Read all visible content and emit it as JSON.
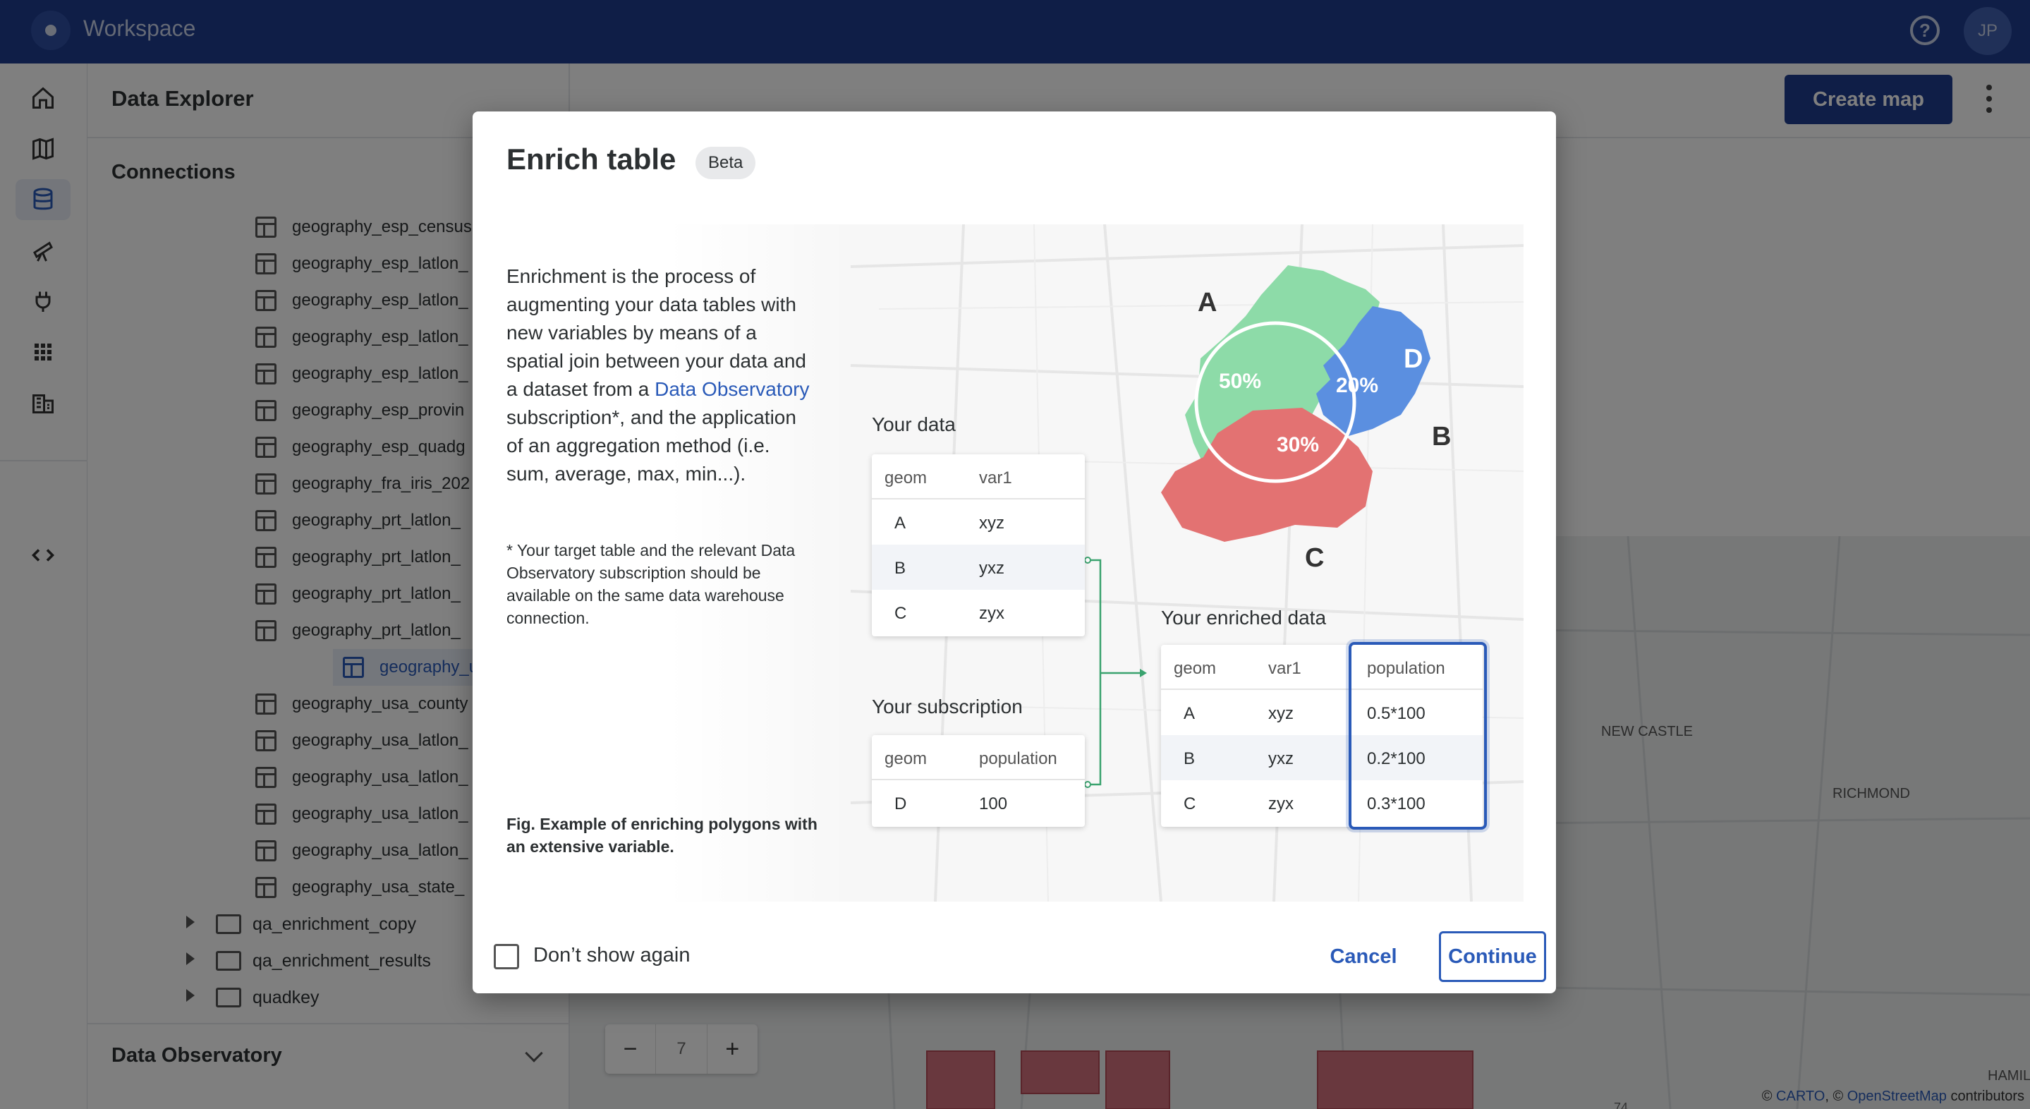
{
  "app": {
    "title": "Workspace",
    "avatar_initials": "JP"
  },
  "rail": {
    "items": [
      "home-icon",
      "map-icon",
      "database-icon",
      "telescope-icon",
      "plug-icon",
      "apps-icon",
      "buildings-icon",
      "code-icon"
    ],
    "active": "database-icon"
  },
  "explorer": {
    "title": "Data Explorer",
    "connections_label": "Connections",
    "tables": [
      "geography_esp_census",
      "geography_esp_latlon_",
      "geography_esp_latlon_",
      "geography_esp_latlon_",
      "geography_esp_latlon_",
      "geography_esp_provin",
      "geography_esp_quadg",
      "geography_fra_iris_202",
      "geography_prt_latlon_",
      "geography_prt_latlon_",
      "geography_prt_latlon_",
      "geography_prt_latlon_",
      "geography_usa_blockg",
      "geography_usa_county",
      "geography_usa_latlon_",
      "geography_usa_latlon_",
      "geography_usa_latlon_",
      "geography_usa_latlon_",
      "geography_usa_state_"
    ],
    "selected_table": "geography_usa_blockg",
    "folders": [
      "qa_enrichment_copy",
      "qa_enrichment_results",
      "quadkey"
    ],
    "data_observatory_label": "Data Observatory"
  },
  "main": {
    "create_map_label": "Create map",
    "zoom": {
      "minus": "−",
      "value": "7",
      "plus": "+"
    },
    "map_labels": [
      "NEW CASTLE",
      "RICHMOND",
      "HAMIL",
      "74"
    ],
    "attribution": {
      "prefix": "© ",
      "carto": "CARTO",
      "sep": ", © ",
      "osm": "OpenStreetMap",
      "suffix": " contributors"
    }
  },
  "dialog": {
    "title": "Enrich table",
    "badge": "Beta",
    "description_pre": "Enrichment is the process of augmenting your data tables with new variables by means of a spatial join between your data and a dataset from a ",
    "description_link": "Data Observatory",
    "description_post": " subscription*, and the application of an aggregation method (i.e. sum, average, max, min...).",
    "note": "* Your target table and the relevant Data Observatory subscription should be available on the same data warehouse connection.",
    "figure_caption": "Fig. Example of enriching polygons with an extensive variable.",
    "dont_show_label": "Don’t show again",
    "cancel_label": "Cancel",
    "continue_label": "Continue",
    "illustration": {
      "your_data": {
        "title": "Your data",
        "headers": [
          "geom",
          "var1"
        ],
        "rows": [
          [
            "A",
            "xyz"
          ],
          [
            "B",
            "yxz"
          ],
          [
            "C",
            "zyx"
          ]
        ]
      },
      "your_subscription": {
        "title": "Your subscription",
        "headers": [
          "geom",
          "population"
        ],
        "rows": [
          [
            "D",
            "100"
          ]
        ]
      },
      "your_enriched_data": {
        "title": "Your enriched data",
        "headers": [
          "geom",
          "var1",
          "population"
        ],
        "rows": [
          [
            "A",
            "xyz",
            "0.5*100"
          ],
          [
            "B",
            "yxz",
            "0.2*100"
          ],
          [
            "C",
            "zyx",
            "0.3*100"
          ]
        ]
      },
      "polygon_labels": {
        "a": "A",
        "b": "B",
        "c": "C",
        "d": "D"
      },
      "shares": {
        "a": "50%",
        "b": "20%",
        "c": "30%"
      },
      "colors": {
        "a": "#8ddba8",
        "b": "#5b8fe0",
        "c": "#e37272"
      }
    }
  }
}
